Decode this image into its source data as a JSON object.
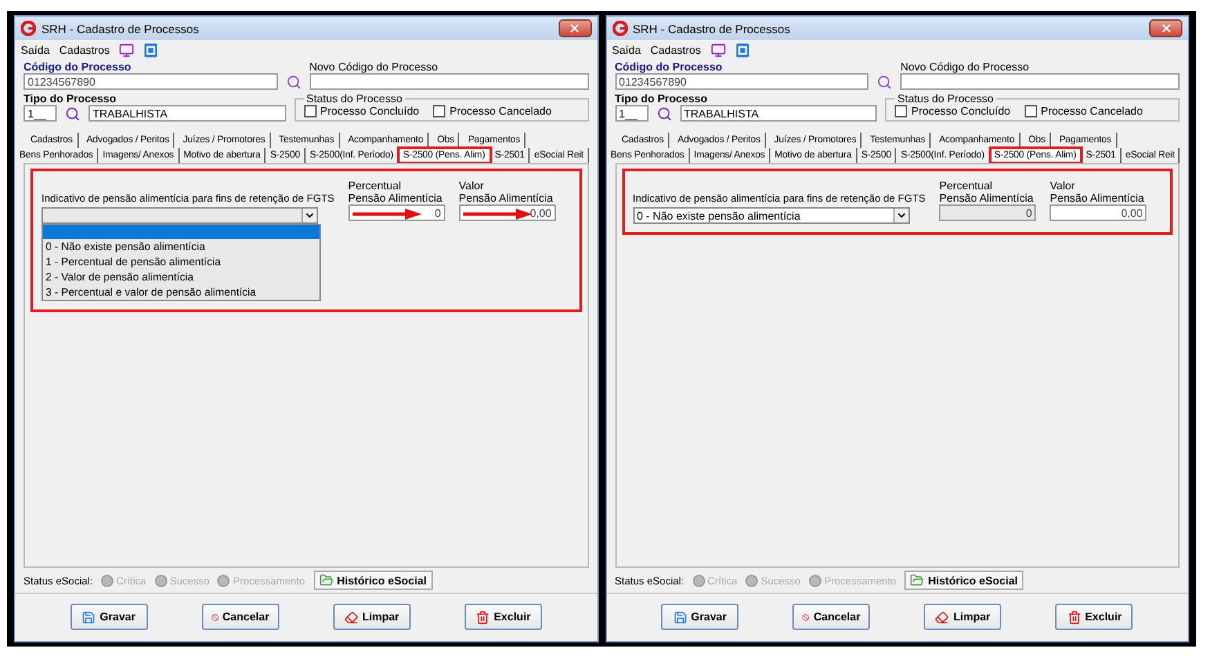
{
  "windows": [
    {
      "title": "SRH - Cadastro de Processos",
      "menu": [
        "Saída",
        "Cadastros"
      ],
      "codigo": {
        "label": "Código do Processo",
        "value": "01234567890"
      },
      "novo": {
        "label": "Novo Código do Processo"
      },
      "tipo": {
        "label": "Tipo do Processo",
        "code": "1__",
        "name": "TRABALHISTA"
      },
      "status": {
        "title": "Status do Processo",
        "options": [
          {
            "label": "Processo Concluído",
            "checked": false
          },
          {
            "label": "Processo Cancelado",
            "checked": false
          }
        ]
      },
      "tab_rows": [
        [
          {
            "label": "Cadastros",
            "selected": false
          },
          {
            "label": "Advogados / Peritos",
            "selected": false
          },
          {
            "label": "Juízes / Promotores",
            "selected": false
          },
          {
            "label": "Testemunhas",
            "selected": false
          },
          {
            "label": "Acompanhamento",
            "selected": false
          },
          {
            "label": "Obs",
            "selected": false
          },
          {
            "label": "Pagamentos",
            "selected": false
          }
        ],
        [
          {
            "label": "Bens Penhorados",
            "selected": false
          },
          {
            "label": "Imagens/ Anexos",
            "selected": false
          },
          {
            "label": "Motivo de abertura",
            "selected": false
          },
          {
            "label": "S-2500",
            "selected": false
          },
          {
            "label": "S-2500(Inf. Período)",
            "selected": false
          },
          {
            "label": "S-2500 (Pens. Alim)",
            "selected": true
          },
          {
            "label": "S-2501",
            "selected": false
          },
          {
            "label": "eSocial Reit",
            "selected": false
          }
        ]
      ],
      "form": {
        "highlighted": true,
        "indicativo": {
          "label": "Indicativo de pensão alimentícia para fins de retenção de FGTS",
          "expanded": true,
          "options": [
            "0 - Não existe pensão alimentícia",
            "1 - Percentual de pensão alimentícia",
            "2 - Valor de pensão alimentícia",
            "3 - Percentual e valor de pensão alimentícia"
          ]
        },
        "fields": [
          {
            "label_lines": [
              "Percentual",
              "Pensão Alimentícia"
            ],
            "value": "0",
            "disabled": false,
            "arrow": true
          },
          {
            "label_lines": [
              "Valor",
              "Pensão Alimentícia"
            ],
            "value": "0,00",
            "disabled": false,
            "arrow": true
          }
        ]
      },
      "status_bar": {
        "label": "Status eSocial:",
        "indicators": [
          "Crítica",
          "Sucesso",
          "Processamento"
        ],
        "history": "Histórico eSocial"
      },
      "buttons": [
        {
          "label": "Gravar",
          "kind": "save"
        },
        {
          "label": "Cancelar",
          "kind": "cancel"
        },
        {
          "label": "Limpar",
          "kind": "clear"
        },
        {
          "label": "Excluir",
          "kind": "delete"
        }
      ]
    },
    {
      "title": "SRH - Cadastro de Processos",
      "menu": [
        "Saída",
        "Cadastros"
      ],
      "codigo": {
        "label": "Código do Processo",
        "value": "01234567890"
      },
      "novo": {
        "label": "Novo Código do Processo"
      },
      "tipo": {
        "label": "Tipo do Processo",
        "code": "1__",
        "name": "TRABALHISTA"
      },
      "status": {
        "title": "Status do Processo",
        "options": [
          {
            "label": "Processo Concluído",
            "checked": false
          },
          {
            "label": "Processo Cancelado",
            "checked": false
          }
        ]
      },
      "tab_rows": [
        [
          {
            "label": "Cadastros",
            "selected": false
          },
          {
            "label": "Advogados / Peritos",
            "selected": false
          },
          {
            "label": "Juízes / Promotores",
            "selected": false
          },
          {
            "label": "Testemunhas",
            "selected": false
          },
          {
            "label": "Acompanhamento",
            "selected": false
          },
          {
            "label": "Obs",
            "selected": false
          },
          {
            "label": "Pagamentos",
            "selected": false
          }
        ],
        [
          {
            "label": "Bens Penhorados",
            "selected": false
          },
          {
            "label": "Imagens/ Anexos",
            "selected": false
          },
          {
            "label": "Motivo de abertura",
            "selected": false
          },
          {
            "label": "S-2500",
            "selected": false
          },
          {
            "label": "S-2500(Inf. Período)",
            "selected": false
          },
          {
            "label": "S-2500 (Pens. Alim)",
            "selected": true
          },
          {
            "label": "S-2501",
            "selected": false
          },
          {
            "label": "eSocial Reit",
            "selected": false
          }
        ]
      ],
      "form": {
        "highlighted": true,
        "indicativo": {
          "label": "Indicativo de pensão alimentícia para fins de retenção de FGTS",
          "value": "0 - Não existe pensão alimentícia",
          "expanded": false
        },
        "fields": [
          {
            "label_lines": [
              "Percentual",
              "Pensão Alimentícia"
            ],
            "value": "0",
            "disabled": true
          },
          {
            "label_lines": [
              "Valor",
              "Pensão Alimentícia"
            ],
            "value": "0,00",
            "disabled": false
          }
        ]
      },
      "status_bar": {
        "label": "Status eSocial:",
        "indicators": [
          "Crítica",
          "Sucesso",
          "Processamento"
        ],
        "history": "Histórico eSocial"
      },
      "buttons": [
        {
          "label": "Gravar",
          "kind": "save"
        },
        {
          "label": "Cancelar",
          "kind": "cancel"
        },
        {
          "label": "Limpar",
          "kind": "clear"
        },
        {
          "label": "Excluir",
          "kind": "delete"
        }
      ]
    }
  ]
}
